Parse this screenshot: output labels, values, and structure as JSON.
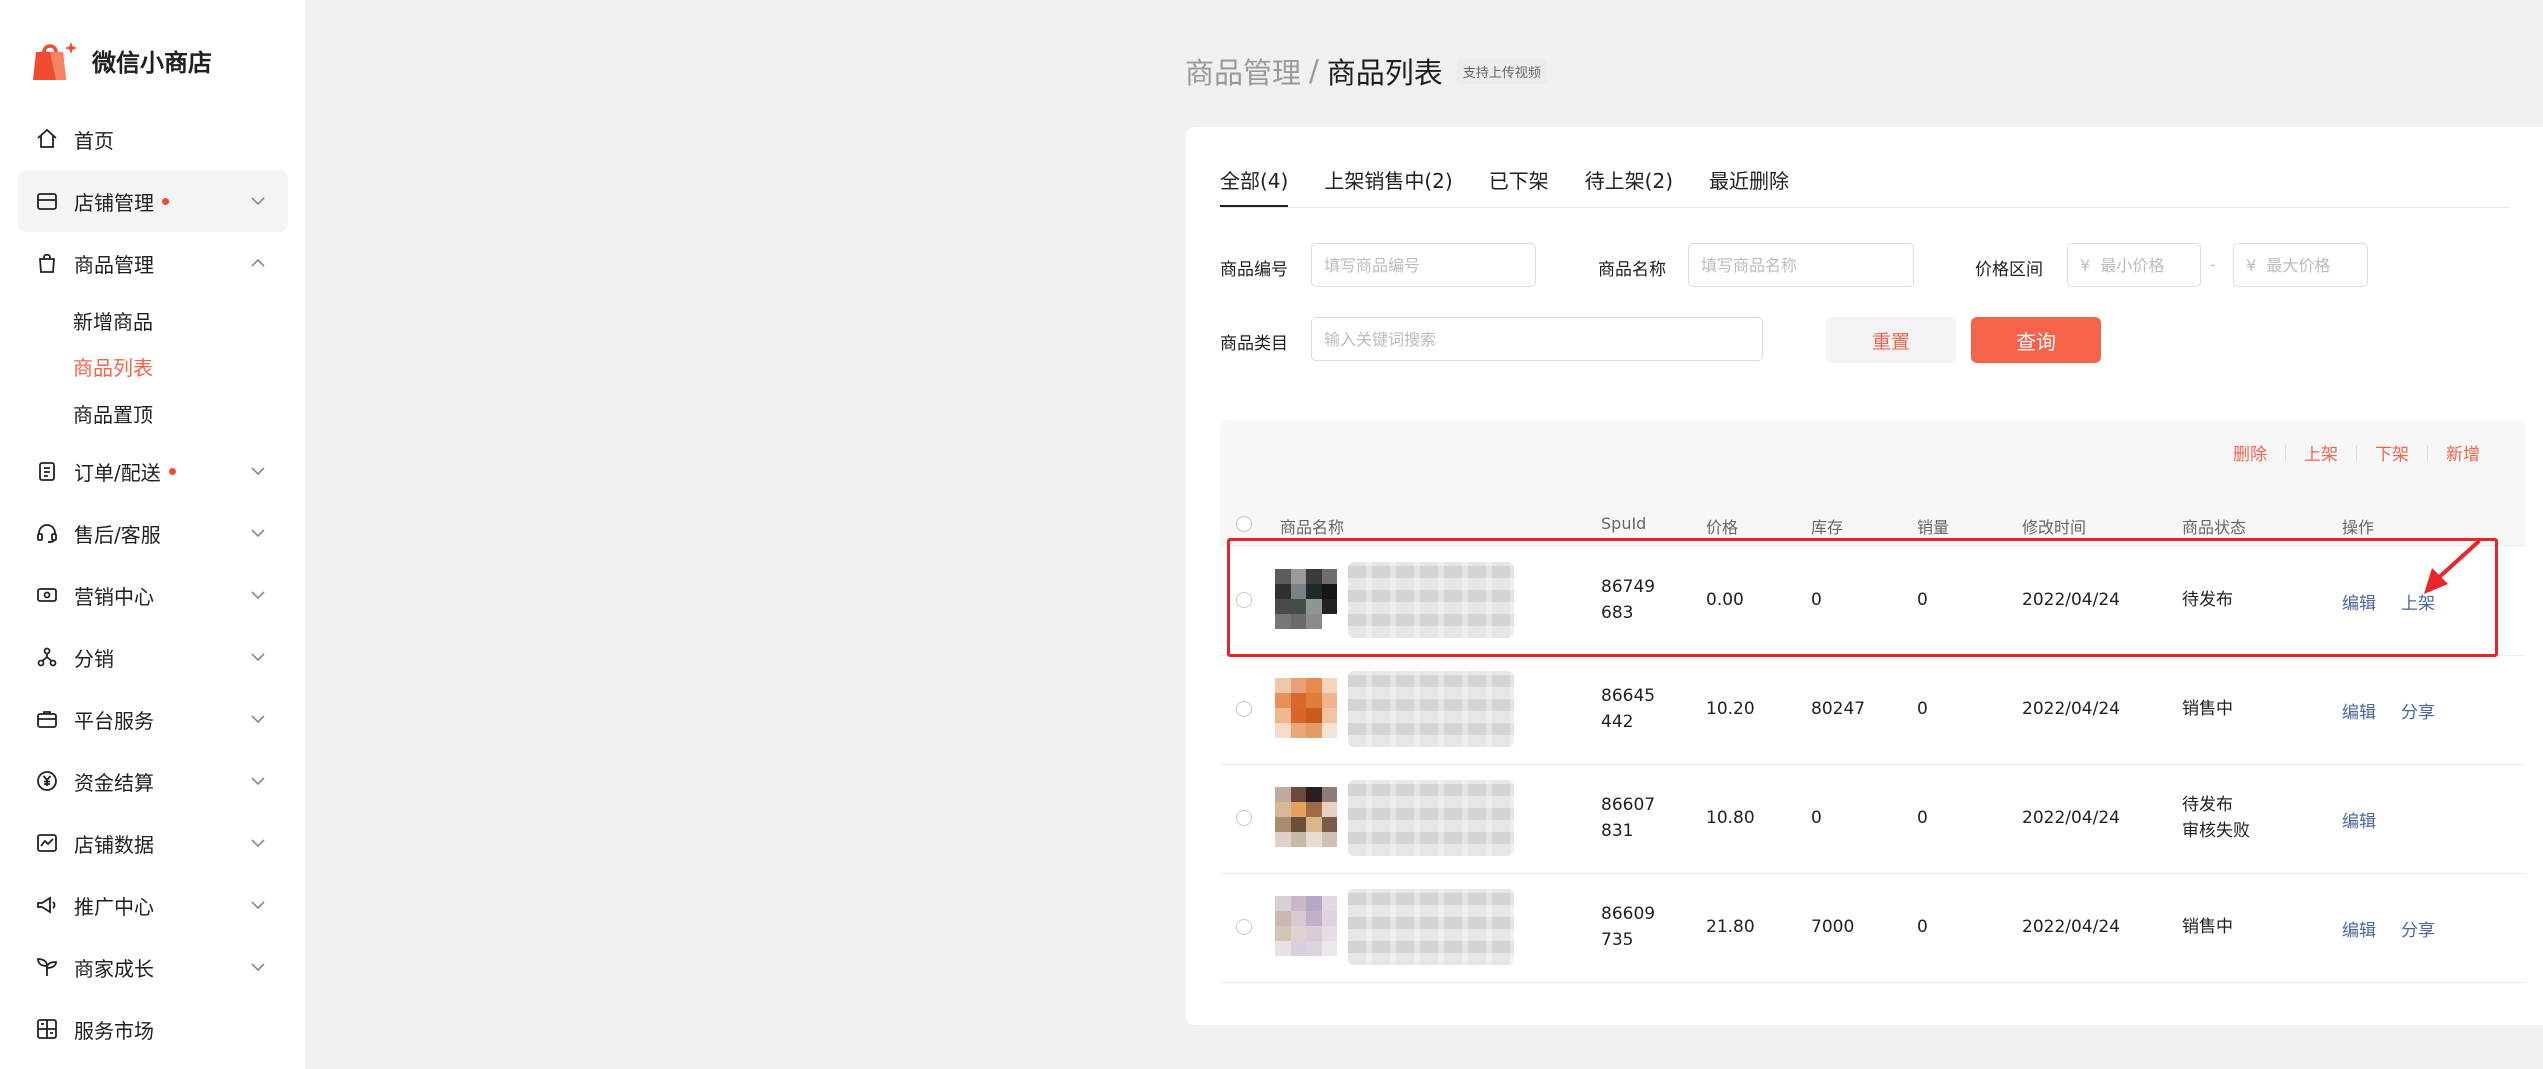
{
  "app": {
    "name": "微信小商店"
  },
  "sidebar": {
    "items": [
      {
        "key": "home",
        "label": "首页",
        "icon": "home-icon",
        "dot": false,
        "chevron": "none"
      },
      {
        "key": "store",
        "label": "店铺管理",
        "icon": "store-icon",
        "dot": true,
        "chevron": "down"
      },
      {
        "key": "goods",
        "label": "商品管理",
        "icon": "bag-icon",
        "dot": false,
        "chevron": "up"
      },
      {
        "key": "orders",
        "label": "订单/配送",
        "icon": "clipboard-icon",
        "dot": true,
        "chevron": "down"
      },
      {
        "key": "service",
        "label": "售后/客服",
        "icon": "headset-icon",
        "dot": false,
        "chevron": "down"
      },
      {
        "key": "marketing",
        "label": "营销中心",
        "icon": "ticket-icon",
        "dot": false,
        "chevron": "down"
      },
      {
        "key": "distribution",
        "label": "分销",
        "icon": "share-nodes-icon",
        "dot": false,
        "chevron": "down"
      },
      {
        "key": "platform",
        "label": "平台服务",
        "icon": "briefcase-icon",
        "dot": false,
        "chevron": "down"
      },
      {
        "key": "funds",
        "label": "资金结算",
        "icon": "yuan-icon",
        "dot": false,
        "chevron": "down"
      },
      {
        "key": "data",
        "label": "店铺数据",
        "icon": "chart-icon",
        "dot": false,
        "chevron": "down"
      },
      {
        "key": "promotion",
        "label": "推广中心",
        "icon": "megaphone-icon",
        "dot": false,
        "chevron": "down"
      },
      {
        "key": "growth",
        "label": "商家成长",
        "icon": "sprout-icon",
        "dot": false,
        "chevron": "down"
      },
      {
        "key": "market",
        "label": "服务市场",
        "icon": "market-icon",
        "dot": false,
        "chevron": "none"
      }
    ],
    "sub_items": [
      {
        "label": "新增商品",
        "current": false
      },
      {
        "label": "商品列表",
        "current": true
      },
      {
        "label": "商品置顶",
        "current": false
      }
    ]
  },
  "breadcrumb": {
    "parent": "商品管理",
    "separator": "/",
    "current": "商品列表",
    "badge": "支持上传视频"
  },
  "tabs": [
    {
      "label": "全部(4)",
      "active": true
    },
    {
      "label": "上架销售中(2)",
      "active": false
    },
    {
      "label": "已下架",
      "active": false
    },
    {
      "label": "待上架(2)",
      "active": false
    },
    {
      "label": "最近删除",
      "active": false
    }
  ],
  "filters": {
    "product_code_label": "商品编号",
    "product_code_placeholder": "填写商品编号",
    "product_name_label": "商品名称",
    "product_name_placeholder": "填写商品名称",
    "price_label": "价格区间",
    "price_min_placeholder": "¥  最小价格",
    "price_dash": "-",
    "price_max_placeholder": "¥  最大价格",
    "category_label": "商品类目",
    "category_placeholder": "输入关键词搜索",
    "reset_label": "重置",
    "query_label": "查询"
  },
  "toolbar": {
    "delete": "删除",
    "shelve": "上架",
    "unshelve": "下架",
    "add": "新增"
  },
  "table": {
    "headers": {
      "name": "商品名称",
      "spuid": "SpuId",
      "price": "价格",
      "stock": "库存",
      "sales": "销量",
      "modified": "修改时间",
      "status": "商品状态",
      "ops": "操作"
    },
    "rows": [
      {
        "spuid_line1": "86749",
        "spuid_line2": "683",
        "price": "0.00",
        "stock": "0",
        "sales": "0",
        "modified": "2022/04/24",
        "status_line1": "待发布",
        "status_line2": "",
        "op1": "编辑",
        "op2": "上架",
        "thumb": [
          "#5b5b5b",
          "#9a9a9a",
          "#3b3b3b",
          "#6e6e6e",
          "#2f2f2f",
          "#7f7f8a",
          "#1e2a28",
          "#161616",
          "#4a4a4a",
          "#3f5048",
          "#8f9690",
          "#222",
          "#777",
          "#6a6a6a",
          "#8b8b8b",
          "#ffffff"
        ]
      },
      {
        "spuid_line1": "86645",
        "spuid_line2": "442",
        "price": "10.20",
        "stock": "80247",
        "sales": "0",
        "modified": "2022/04/24",
        "status_line1": "销售中",
        "status_line2": "",
        "op1": "编辑",
        "op2": "分享",
        "thumb": [
          "#f2c6a8",
          "#e9a072",
          "#e88a4e",
          "#f4d4bc",
          "#e7905a",
          "#d76a2a",
          "#e07c3c",
          "#f1b58a",
          "#f0b88f",
          "#d8662a",
          "#c95a1e",
          "#f0c4a2",
          "#f6dcc8",
          "#eaa678",
          "#e49a66",
          "#f7e2d2"
        ]
      },
      {
        "spuid_line1": "86607",
        "spuid_line2": "831",
        "price": "10.80",
        "stock": "0",
        "sales": "0",
        "modified": "2022/04/24",
        "status_line1": "待发布",
        "status_line2": "审核失败",
        "op1": "编辑",
        "op2": "",
        "thumb": [
          "#c2a9a2",
          "#6b4a3c",
          "#2a1f1c",
          "#8e7c74",
          "#d9b79a",
          "#e6a25a",
          "#a06a44",
          "#e8d0c2",
          "#a88c6c",
          "#6a5038",
          "#d8b888",
          "#7a5a48",
          "#e0d0c8",
          "#c8b8a8",
          "#e8dcd4",
          "#d0c0b8"
        ]
      },
      {
        "spuid_line1": "86609",
        "spuid_line2": "735",
        "price": "21.80",
        "stock": "7000",
        "sales": "0",
        "modified": "2022/04/24",
        "status_line1": "销售中",
        "status_line2": "",
        "op1": "编辑",
        "op2": "分享",
        "thumb": [
          "#d9cfd6",
          "#c9b8c8",
          "#b8a8c8",
          "#e2d8e2",
          "#cbb8b0",
          "#d8c8d0",
          "#c0b0c8",
          "#e0d4dc",
          "#d4c4b4",
          "#e0d0d0",
          "#d8ccd8",
          "#e6dce4",
          "#e8e0e6",
          "#d8d0dc",
          "#dcd2e0",
          "#ece6ee"
        ]
      }
    ]
  },
  "colors": {
    "accent": "#f5644a",
    "link": "#4a66a0",
    "highlight": "#e8262a",
    "dot": "#f04a31"
  }
}
